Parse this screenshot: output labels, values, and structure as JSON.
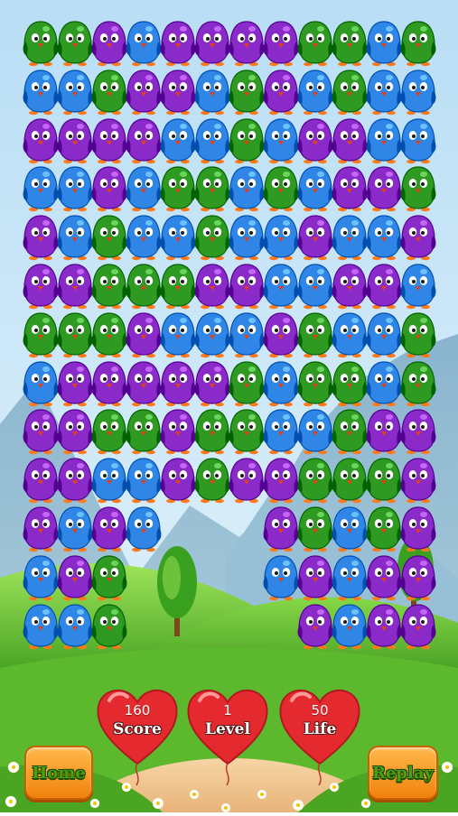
{
  "hud": {
    "score_value": "160",
    "score_label": "Score",
    "level_value": "1",
    "level_label": "Level",
    "life_value": "50",
    "life_label": "Life"
  },
  "buttons": {
    "home_label": "Home",
    "replay_label": "Replay"
  },
  "colors": {
    "green": "#2f9a22",
    "blue": "#2f86e6",
    "purple": "#8a2bc9",
    "heart": "#e52a2f",
    "button": "#f59a1d"
  },
  "board": {
    "grid": [
      "GGPBPPPPGGBG",
      "BBGPPBGPBGBB",
      "PPPPBBGBPPBB",
      "BBPBGGBGBPPG",
      "PBGBBGBBPBBP",
      "PPGGGPPBBPPB",
      "GGGPBBBPGBBG",
      "BPPPPPGBGGBG",
      "PPGGPGGBBGPP",
      "PPBBPGPPGGGP",
      "PBPB...PGBGP",
      "BPG....BPBPP",
      "BBG.....PBPP"
    ]
  }
}
